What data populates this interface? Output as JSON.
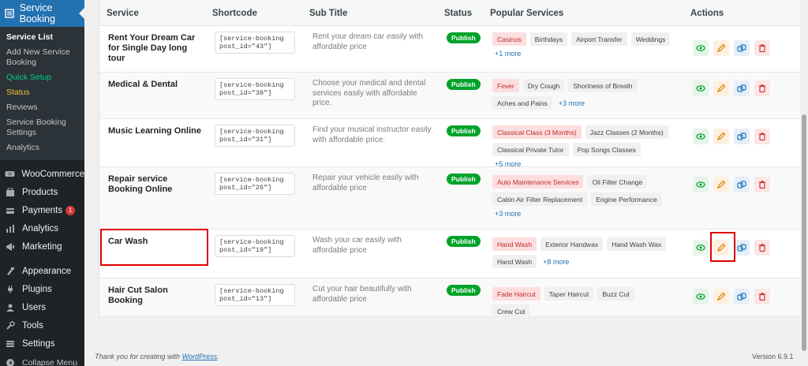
{
  "sidebar": {
    "active": "Service Booking",
    "submenu": [
      {
        "label": "Service List",
        "style": "current"
      },
      {
        "label": "Add New Service Booking",
        "style": ""
      },
      {
        "label": "Quick Setup",
        "style": "green"
      },
      {
        "label": "Status",
        "style": "yellow"
      },
      {
        "label": "Reviews",
        "style": ""
      },
      {
        "label": "Service Booking Settings",
        "style": ""
      },
      {
        "label": "Analytics",
        "style": ""
      }
    ],
    "items": [
      {
        "label": "WooCommerce",
        "icon": "woocommerce-icon"
      },
      {
        "label": "Products",
        "icon": "products-icon"
      },
      {
        "label": "Payments",
        "icon": "payments-icon",
        "badge": "1"
      },
      {
        "label": "Analytics",
        "icon": "analytics-icon"
      },
      {
        "label": "Marketing",
        "icon": "marketing-icon"
      },
      {
        "label": "Appearance",
        "icon": "appearance-icon"
      },
      {
        "label": "Plugins",
        "icon": "plugins-icon"
      },
      {
        "label": "Users",
        "icon": "users-icon"
      },
      {
        "label": "Tools",
        "icon": "tools-icon"
      },
      {
        "label": "Settings",
        "icon": "settings-icon"
      },
      {
        "label": "Collapse Menu",
        "icon": "collapse-icon"
      }
    ]
  },
  "table": {
    "headers": {
      "service": "Service",
      "shortcode": "Shortcode",
      "subtitle": "Sub Title",
      "status": "Status",
      "popular": "Popular Services",
      "actions": "Actions"
    },
    "rows": [
      {
        "name": "Rent Your Dream Car for Single Day long tour",
        "shortcode": "[service-booking post_id=\"43\"]",
        "subtitle": "Rent your dream car easily with affordable price",
        "status": "Publish",
        "tags": [
          {
            "t": "Casinos",
            "hl": true
          },
          {
            "t": "Birthdays"
          },
          {
            "t": "Airport Transfer"
          },
          {
            "t": "Weddings"
          }
        ],
        "more": "+1 more"
      },
      {
        "name": "Medical & Dental",
        "shortcode": "[service-booking post_id=\"38\"]",
        "subtitle": "Choose your medical and dental services easily with affordable price.",
        "status": "Publish",
        "tags": [
          {
            "t": "Fever",
            "hl": true
          },
          {
            "t": "Dry Cough"
          },
          {
            "t": "Shortness of Breath"
          },
          {
            "t": "Aches and Pains"
          }
        ],
        "more": "+3 more"
      },
      {
        "name": "Music Learning Online",
        "shortcode": "[service-booking post_id=\"31\"]",
        "subtitle": "Find your musical instructor easily with affordable price.",
        "status": "Publish",
        "tags": [
          {
            "t": "Classical Class (3 Months)",
            "hl": true
          },
          {
            "t": "Jazz Classes (2 Months)"
          },
          {
            "t": "Classical Private Tutor"
          },
          {
            "t": "Pop Songs Classes"
          }
        ],
        "more": "+5 more"
      },
      {
        "name": "Repair service Booking Online",
        "shortcode": "[service-booking post_id=\"26\"]",
        "subtitle": "Repair your vehicle easily with affordable price",
        "status": "Publish",
        "tags": [
          {
            "t": "Auto Maintenance Services",
            "hl": true
          },
          {
            "t": "Oil Filter Change"
          },
          {
            "t": "Cabin Air Filter Replacement"
          },
          {
            "t": "Engine Performance"
          }
        ],
        "more": "+3 more"
      },
      {
        "name": "Car Wash",
        "shortcode": "[service-booking post_id=\"19\"]",
        "subtitle": "Wash your car easily with affordable price",
        "status": "Publish",
        "tags": [
          {
            "t": "Hand Wash",
            "hl": true
          },
          {
            "t": "Exterior Handwax"
          },
          {
            "t": "Hand Wash Wax"
          },
          {
            "t": "Hand Wash"
          }
        ],
        "more": "+8 more"
      },
      {
        "name": "Hair Cut Salon Booking",
        "shortcode": "[service-booking post_id=\"13\"]",
        "subtitle": "Cut your hair beautifully with affordable price",
        "status": "Publish",
        "tags": [
          {
            "t": "Fade Haircut",
            "hl": true
          },
          {
            "t": "Taper Haircut"
          },
          {
            "t": "Buzz Cut"
          },
          {
            "t": "Crew Cut"
          }
        ],
        "more": ""
      }
    ]
  },
  "footer": {
    "thanks": "Thank you for creating with ",
    "link": "WordPress",
    "period": ".",
    "version": "Version 6.9.1"
  }
}
